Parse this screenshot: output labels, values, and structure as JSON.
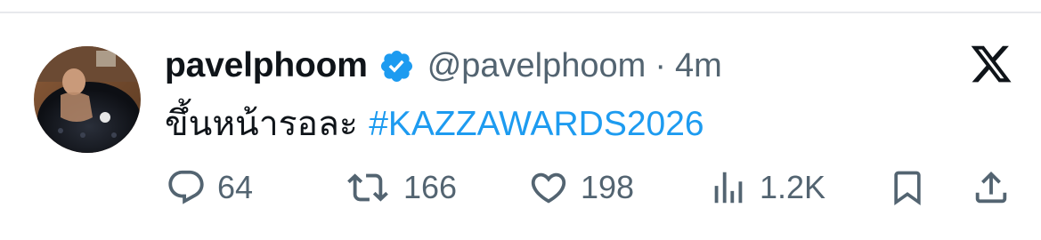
{
  "tweet": {
    "display_name": "pavelphoom",
    "handle": "@pavelphoom",
    "separator": "·",
    "timestamp": "4m",
    "text": "ขึ้นหน้ารอละ ",
    "hashtag": "#KAZZAWARDS2026",
    "verified_icon": "verified-badge-icon",
    "brand_icon": "x-logo-icon"
  },
  "actions": {
    "replies": "64",
    "reposts": "166",
    "likes": "198",
    "views": "1.2K"
  },
  "colors": {
    "link": "#1d9bf0",
    "secondary_text": "#536471",
    "primary_text": "#0f1419"
  }
}
